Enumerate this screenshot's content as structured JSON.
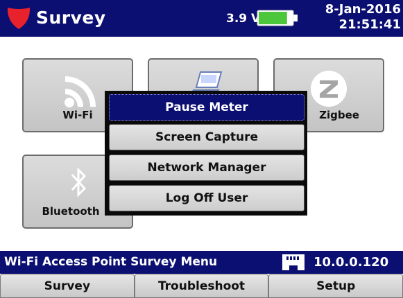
{
  "header": {
    "title": "Survey",
    "voltage": "3.9 V",
    "date": "8-Jan-2016",
    "time": "21:51:41",
    "brand_icon": "shield-icon",
    "battery_icon": "battery-icon",
    "battery_level": 0.85,
    "colors": {
      "bar": "#0b0f72",
      "brand": "#e8222c",
      "battery": "#4cc63a"
    }
  },
  "tiles": [
    {
      "label": "Wi-Fi",
      "icon": "wifi-icon"
    },
    {
      "label": "",
      "icon": "laptop-icon"
    },
    {
      "label": "Zigbee",
      "icon": "zigbee-icon"
    },
    {
      "label": "Bluetooth",
      "icon": "bluetooth-icon"
    }
  ],
  "popup_menu": {
    "items": [
      {
        "label": "Pause Meter",
        "selected": true
      },
      {
        "label": "Screen Capture",
        "selected": false
      },
      {
        "label": "Network Manager",
        "selected": false
      },
      {
        "label": "Log Off User",
        "selected": false
      }
    ]
  },
  "status_bar": {
    "text": "Wi-Fi Access Point Survey Menu",
    "network_icon": "ethernet-port-icon",
    "ip": "10.0.0.120"
  },
  "tabs": [
    {
      "label": "Survey"
    },
    {
      "label": "Troubleshoot"
    },
    {
      "label": "Setup"
    }
  ]
}
